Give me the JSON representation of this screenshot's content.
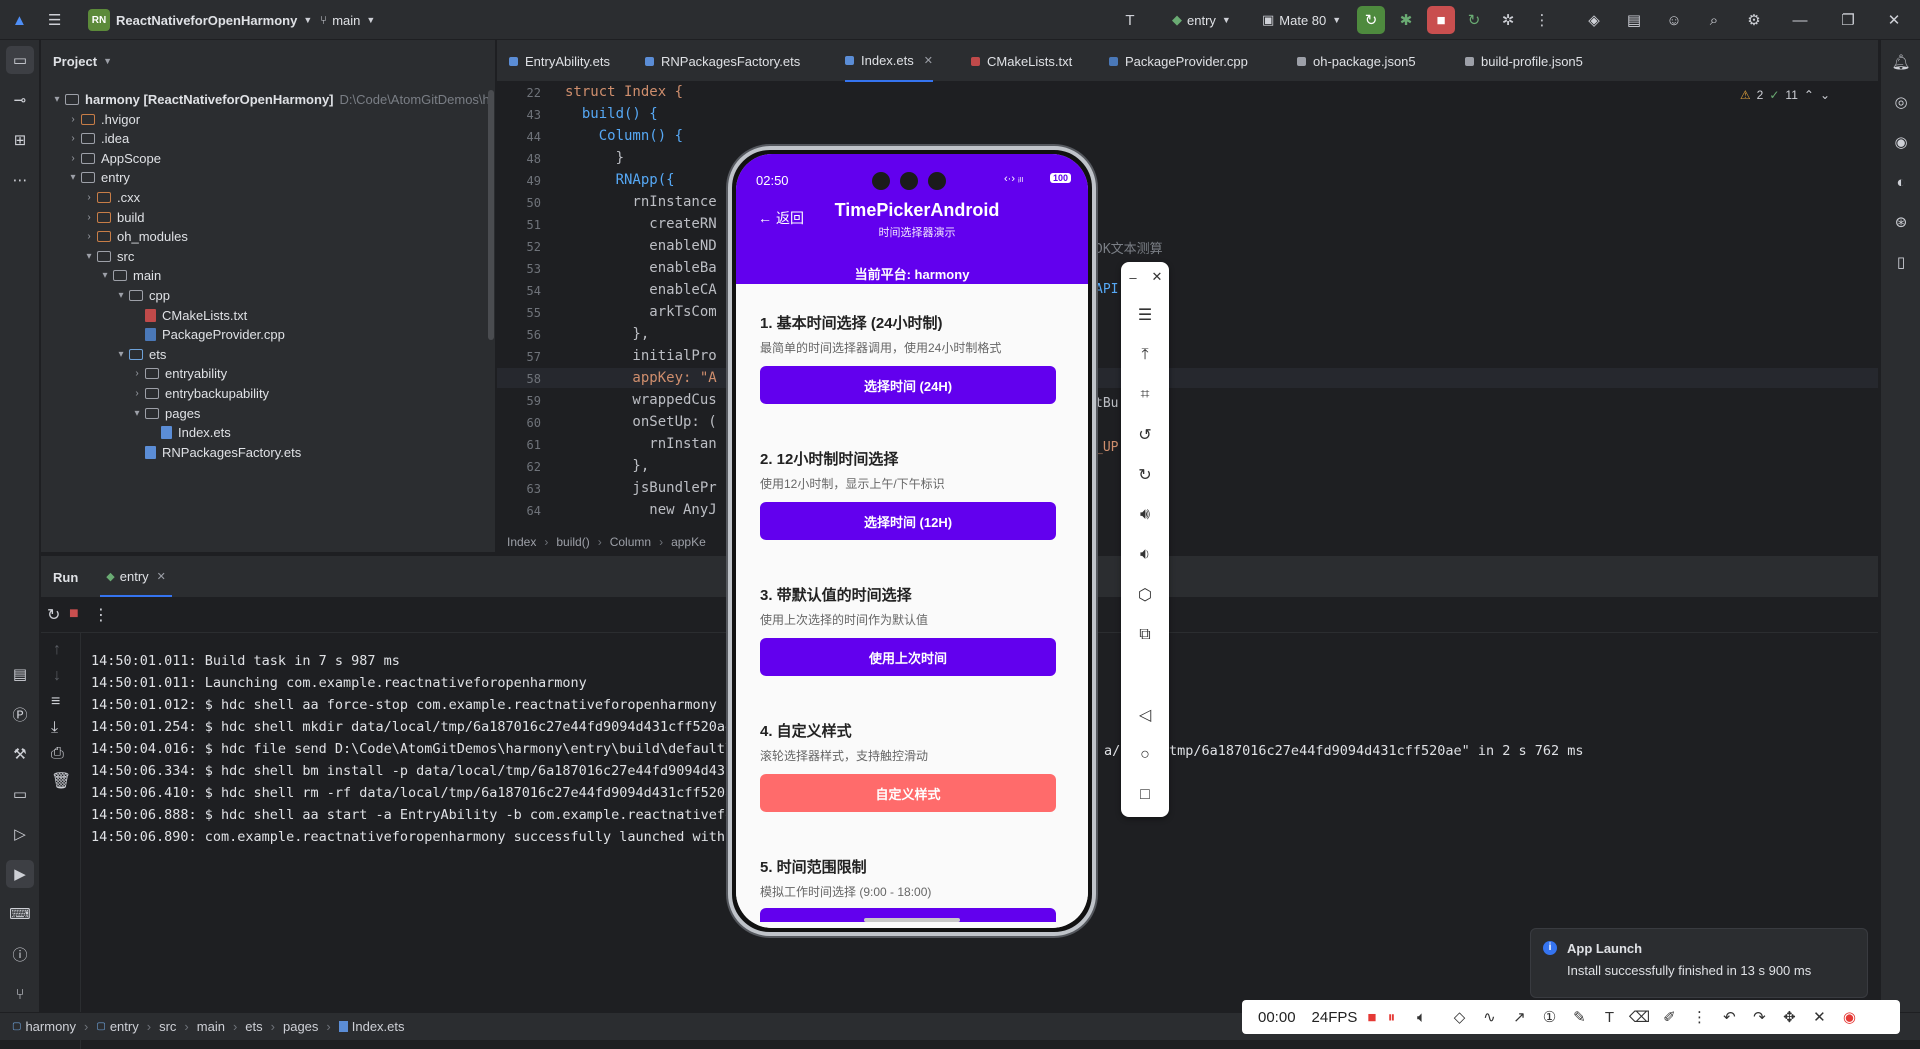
{
  "titlebar": {
    "project_badge": "RN",
    "project_name": "ReactNativeforOpenHarmony",
    "branch": "main",
    "run_config": "entry",
    "device": "Mate 80"
  },
  "project_panel": {
    "title": "Project",
    "tree": [
      {
        "label": "harmony [ReactNativeforOpenHarmony]",
        "path": "D:\\Code\\AtomGitDemos\\h",
        "depth": 0,
        "expanded": true
      },
      {
        "label": ".hvigor",
        "depth": 1,
        "kind": "orange"
      },
      {
        "label": ".idea",
        "depth": 1,
        "kind": "plain"
      },
      {
        "label": "AppScope",
        "depth": 1,
        "kind": "plain"
      },
      {
        "label": "entry",
        "depth": 1,
        "kind": "plain",
        "expanded": true
      },
      {
        "label": ".cxx",
        "depth": 2,
        "kind": "orange"
      },
      {
        "label": "build",
        "depth": 2,
        "kind": "orange"
      },
      {
        "label": "oh_modules",
        "depth": 2,
        "kind": "orange"
      },
      {
        "label": "src",
        "depth": 2,
        "kind": "plain",
        "expanded": true
      },
      {
        "label": "main",
        "depth": 3,
        "kind": "plain",
        "expanded": true
      },
      {
        "label": "cpp",
        "depth": 4,
        "kind": "plain",
        "expanded": true
      },
      {
        "label": "CMakeLists.txt",
        "depth": 5,
        "kind": "file-cmake"
      },
      {
        "label": "PackageProvider.cpp",
        "depth": 5,
        "kind": "file-cpp"
      },
      {
        "label": "ets",
        "depth": 4,
        "kind": "blue",
        "expanded": true
      },
      {
        "label": "entryability",
        "depth": 5,
        "kind": "plain"
      },
      {
        "label": "entrybackupability",
        "depth": 5,
        "kind": "plain"
      },
      {
        "label": "pages",
        "depth": 5,
        "kind": "plain",
        "expanded": true
      },
      {
        "label": "Index.ets",
        "depth": 6,
        "kind": "file-ets"
      },
      {
        "label": "RNPackagesFactory.ets",
        "depth": 5,
        "kind": "file-ets"
      }
    ]
  },
  "editor": {
    "tabs": [
      {
        "label": "EntryAbility.ets"
      },
      {
        "label": "RNPackagesFactory.ets"
      },
      {
        "label": "Index.ets",
        "active": true
      },
      {
        "label": "CMakeLists.txt"
      },
      {
        "label": "PackageProvider.cpp"
      },
      {
        "label": "oh-package.json5"
      },
      {
        "label": "build-profile.json5"
      }
    ],
    "inspection": {
      "warnings": "2",
      "checks": "11"
    },
    "lines": [
      {
        "n": "22",
        "text": "struct Index {"
      },
      {
        "n": "43",
        "text": "  build() {"
      },
      {
        "n": "44",
        "text": "    Column() {"
      },
      {
        "n": "48",
        "text": "      }"
      },
      {
        "n": "49",
        "text": "      RNApp({"
      },
      {
        "n": "50",
        "text": "        rnInstance"
      },
      {
        "n": "51",
        "text": "          createRN"
      },
      {
        "n": "52",
        "text": "          enableND"
      },
      {
        "n": "53",
        "text": "          enableBa"
      },
      {
        "n": "54",
        "text": "          enableCA"
      },
      {
        "n": "55",
        "text": "          arkTsCom"
      },
      {
        "n": "56",
        "text": "        },"
      },
      {
        "n": "57",
        "text": "        initialPro"
      },
      {
        "n": "58",
        "text": "        appKey: \"A"
      },
      {
        "n": "59",
        "text": "        wrappedCus"
      },
      {
        "n": "60",
        "text": "        onSetUp: ("
      },
      {
        "n": "61",
        "text": "          rnInstan"
      },
      {
        "n": "62",
        "text": "        },"
      },
      {
        "n": "63",
        "text": "        jsBundlePr"
      },
      {
        "n": "64",
        "text": "          new AnyJ"
      }
    ],
    "right_fragments": [
      "DK文本测算",
      "API",
      "tBu",
      "_UP"
    ],
    "breadcrumbs": [
      "Index",
      "build()",
      "Column",
      "appKe"
    ]
  },
  "run_panel": {
    "title": "Run",
    "tab": "entry",
    "logs": [
      "14:50:01.011: Build task in 7 s 987 ms",
      "14:50:01.011: Launching com.example.reactnativeforopenharmony",
      "14:50:01.012: $ hdc shell aa force-stop com.example.reactnativeforopenharmony",
      "14:50:01.254: $ hdc shell mkdir data/local/tmp/6a187016c27e44fd9094d431cff520ae",
      "14:50:04.016: $ hdc file send D:\\Code\\AtomGitDemos\\harmony\\entry\\build\\default\\c",
      "14:50:06.334: $ hdc shell bm install -p data/local/tmp/6a187016c27e44fd9094d431c",
      "14:50:06.410: $ hdc shell rm -rf data/local/tmp/6a187016c27e44fd9094d431cff520ae",
      "14:50:06.888: $ hdc shell aa start -a EntryAbility -b com.example.reactnativefor",
      "14:50:06.890: com.example.reactnativeforopenharmony successfully launched within"
    ],
    "log_tail": "a/l     tmp/6a187016c27e44fd9094d431cff520ae\" in 2 s 762 ms"
  },
  "statusbar": {
    "path": [
      "harmony",
      "entry",
      "src",
      "main",
      "ets",
      "pages",
      "Index.ets"
    ]
  },
  "phone": {
    "time": "02:50",
    "battery": "100",
    "back_label": "返回",
    "title": "TimePickerAndroid",
    "subtitle": "时间选择器演示",
    "platform": "当前平台: harmony",
    "colors": {
      "primary": "#6200ee",
      "custom": "#ff6b6b"
    },
    "sections": [
      {
        "title": "1. 基本时间选择 (24小时制)",
        "desc": "最简单的时间选择器调用，使用24小时制格式",
        "button": "选择时间 (24H)"
      },
      {
        "title": "2. 12小时制时间选择",
        "desc": "使用12小时制，显示上午/下午标识",
        "button": "选择时间 (12H)"
      },
      {
        "title": "3. 带默认值的时间选择",
        "desc": "使用上次选择的时间作为默认值",
        "button": "使用上次时间"
      },
      {
        "title": "4. 自定义样式",
        "desc": "滚轮选择器样式，支持触控滑动",
        "button": "自定义样式"
      },
      {
        "title": "5. 时间范围限制",
        "desc": "模拟工作时间选择 (9:00 - 18:00)",
        "button": ""
      }
    ]
  },
  "notification": {
    "title": "App Launch",
    "message": "Install successfully finished in 13 s 900 ms"
  },
  "recorder": {
    "time": "00:00",
    "fps": "24FPS"
  }
}
